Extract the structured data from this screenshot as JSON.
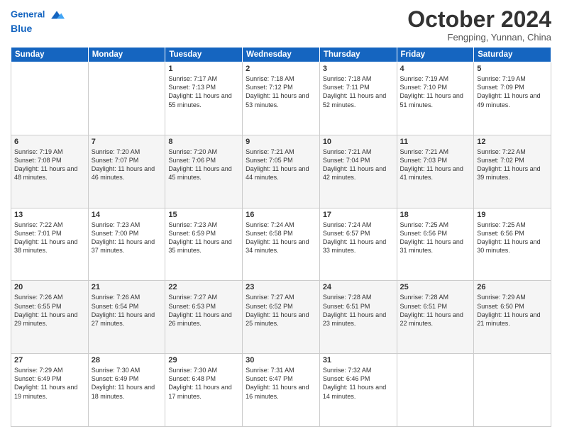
{
  "header": {
    "logo_line1": "General",
    "logo_line2": "Blue",
    "month": "October 2024",
    "location": "Fengping, Yunnan, China"
  },
  "weekdays": [
    "Sunday",
    "Monday",
    "Tuesday",
    "Wednesday",
    "Thursday",
    "Friday",
    "Saturday"
  ],
  "weeks": [
    [
      {
        "day": "",
        "sunrise": "",
        "sunset": "",
        "daylight": ""
      },
      {
        "day": "",
        "sunrise": "",
        "sunset": "",
        "daylight": ""
      },
      {
        "day": "1",
        "sunrise": "Sunrise: 7:17 AM",
        "sunset": "Sunset: 7:13 PM",
        "daylight": "Daylight: 11 hours and 55 minutes."
      },
      {
        "day": "2",
        "sunrise": "Sunrise: 7:18 AM",
        "sunset": "Sunset: 7:12 PM",
        "daylight": "Daylight: 11 hours and 53 minutes."
      },
      {
        "day": "3",
        "sunrise": "Sunrise: 7:18 AM",
        "sunset": "Sunset: 7:11 PM",
        "daylight": "Daylight: 11 hours and 52 minutes."
      },
      {
        "day": "4",
        "sunrise": "Sunrise: 7:19 AM",
        "sunset": "Sunset: 7:10 PM",
        "daylight": "Daylight: 11 hours and 51 minutes."
      },
      {
        "day": "5",
        "sunrise": "Sunrise: 7:19 AM",
        "sunset": "Sunset: 7:09 PM",
        "daylight": "Daylight: 11 hours and 49 minutes."
      }
    ],
    [
      {
        "day": "6",
        "sunrise": "Sunrise: 7:19 AM",
        "sunset": "Sunset: 7:08 PM",
        "daylight": "Daylight: 11 hours and 48 minutes."
      },
      {
        "day": "7",
        "sunrise": "Sunrise: 7:20 AM",
        "sunset": "Sunset: 7:07 PM",
        "daylight": "Daylight: 11 hours and 46 minutes."
      },
      {
        "day": "8",
        "sunrise": "Sunrise: 7:20 AM",
        "sunset": "Sunset: 7:06 PM",
        "daylight": "Daylight: 11 hours and 45 minutes."
      },
      {
        "day": "9",
        "sunrise": "Sunrise: 7:21 AM",
        "sunset": "Sunset: 7:05 PM",
        "daylight": "Daylight: 11 hours and 44 minutes."
      },
      {
        "day": "10",
        "sunrise": "Sunrise: 7:21 AM",
        "sunset": "Sunset: 7:04 PM",
        "daylight": "Daylight: 11 hours and 42 minutes."
      },
      {
        "day": "11",
        "sunrise": "Sunrise: 7:21 AM",
        "sunset": "Sunset: 7:03 PM",
        "daylight": "Daylight: 11 hours and 41 minutes."
      },
      {
        "day": "12",
        "sunrise": "Sunrise: 7:22 AM",
        "sunset": "Sunset: 7:02 PM",
        "daylight": "Daylight: 11 hours and 39 minutes."
      }
    ],
    [
      {
        "day": "13",
        "sunrise": "Sunrise: 7:22 AM",
        "sunset": "Sunset: 7:01 PM",
        "daylight": "Daylight: 11 hours and 38 minutes."
      },
      {
        "day": "14",
        "sunrise": "Sunrise: 7:23 AM",
        "sunset": "Sunset: 7:00 PM",
        "daylight": "Daylight: 11 hours and 37 minutes."
      },
      {
        "day": "15",
        "sunrise": "Sunrise: 7:23 AM",
        "sunset": "Sunset: 6:59 PM",
        "daylight": "Daylight: 11 hours and 35 minutes."
      },
      {
        "day": "16",
        "sunrise": "Sunrise: 7:24 AM",
        "sunset": "Sunset: 6:58 PM",
        "daylight": "Daylight: 11 hours and 34 minutes."
      },
      {
        "day": "17",
        "sunrise": "Sunrise: 7:24 AM",
        "sunset": "Sunset: 6:57 PM",
        "daylight": "Daylight: 11 hours and 33 minutes."
      },
      {
        "day": "18",
        "sunrise": "Sunrise: 7:25 AM",
        "sunset": "Sunset: 6:56 PM",
        "daylight": "Daylight: 11 hours and 31 minutes."
      },
      {
        "day": "19",
        "sunrise": "Sunrise: 7:25 AM",
        "sunset": "Sunset: 6:56 PM",
        "daylight": "Daylight: 11 hours and 30 minutes."
      }
    ],
    [
      {
        "day": "20",
        "sunrise": "Sunrise: 7:26 AM",
        "sunset": "Sunset: 6:55 PM",
        "daylight": "Daylight: 11 hours and 29 minutes."
      },
      {
        "day": "21",
        "sunrise": "Sunrise: 7:26 AM",
        "sunset": "Sunset: 6:54 PM",
        "daylight": "Daylight: 11 hours and 27 minutes."
      },
      {
        "day": "22",
        "sunrise": "Sunrise: 7:27 AM",
        "sunset": "Sunset: 6:53 PM",
        "daylight": "Daylight: 11 hours and 26 minutes."
      },
      {
        "day": "23",
        "sunrise": "Sunrise: 7:27 AM",
        "sunset": "Sunset: 6:52 PM",
        "daylight": "Daylight: 11 hours and 25 minutes."
      },
      {
        "day": "24",
        "sunrise": "Sunrise: 7:28 AM",
        "sunset": "Sunset: 6:51 PM",
        "daylight": "Daylight: 11 hours and 23 minutes."
      },
      {
        "day": "25",
        "sunrise": "Sunrise: 7:28 AM",
        "sunset": "Sunset: 6:51 PM",
        "daylight": "Daylight: 11 hours and 22 minutes."
      },
      {
        "day": "26",
        "sunrise": "Sunrise: 7:29 AM",
        "sunset": "Sunset: 6:50 PM",
        "daylight": "Daylight: 11 hours and 21 minutes."
      }
    ],
    [
      {
        "day": "27",
        "sunrise": "Sunrise: 7:29 AM",
        "sunset": "Sunset: 6:49 PM",
        "daylight": "Daylight: 11 hours and 19 minutes."
      },
      {
        "day": "28",
        "sunrise": "Sunrise: 7:30 AM",
        "sunset": "Sunset: 6:49 PM",
        "daylight": "Daylight: 11 hours and 18 minutes."
      },
      {
        "day": "29",
        "sunrise": "Sunrise: 7:30 AM",
        "sunset": "Sunset: 6:48 PM",
        "daylight": "Daylight: 11 hours and 17 minutes."
      },
      {
        "day": "30",
        "sunrise": "Sunrise: 7:31 AM",
        "sunset": "Sunset: 6:47 PM",
        "daylight": "Daylight: 11 hours and 16 minutes."
      },
      {
        "day": "31",
        "sunrise": "Sunrise: 7:32 AM",
        "sunset": "Sunset: 6:46 PM",
        "daylight": "Daylight: 11 hours and 14 minutes."
      },
      {
        "day": "",
        "sunrise": "",
        "sunset": "",
        "daylight": ""
      },
      {
        "day": "",
        "sunrise": "",
        "sunset": "",
        "daylight": ""
      }
    ]
  ]
}
